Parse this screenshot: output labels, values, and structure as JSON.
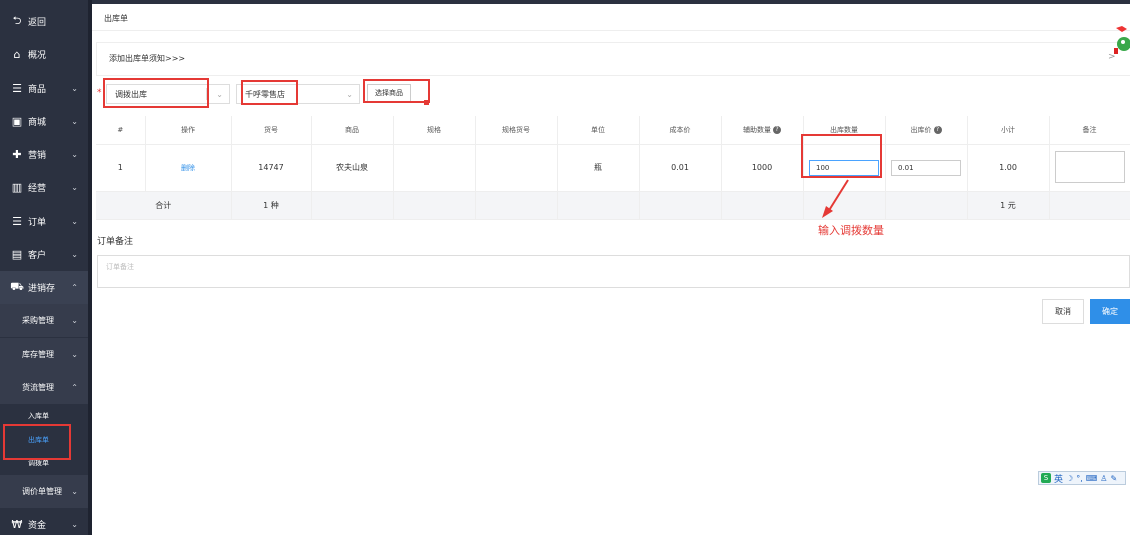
{
  "sidebar": {
    "items": [
      {
        "label": "返回",
        "icon": "back-arrow-icon",
        "glyph": "⮌"
      },
      {
        "label": "概况",
        "icon": "home-icon",
        "glyph": "⌂"
      },
      {
        "label": "商品",
        "icon": "list-icon",
        "glyph": "☰"
      },
      {
        "label": "商城",
        "icon": "shop-bag-icon",
        "glyph": "▣"
      },
      {
        "label": "营销",
        "icon": "gift-icon",
        "glyph": "✚"
      },
      {
        "label": "经营",
        "icon": "bar-chart-icon",
        "glyph": "▥"
      },
      {
        "label": "订单",
        "icon": "order-list-icon",
        "glyph": "☰"
      },
      {
        "label": "客户",
        "icon": "id-card-icon",
        "glyph": "▤"
      },
      {
        "label": "进销存",
        "icon": "truck-icon",
        "glyph": "⛟"
      }
    ],
    "sub_items": [
      {
        "label": "采购管理"
      },
      {
        "label": "库存管理"
      },
      {
        "label": "货流管理"
      }
    ],
    "leaf_items": [
      {
        "label": "入库单"
      },
      {
        "label": "出库单"
      },
      {
        "label": "调拨单"
      }
    ],
    "more_items": [
      {
        "label": "调价单管理"
      }
    ],
    "bottom_item": {
      "label": "资金",
      "icon": "currency-icon",
      "glyph": "₩"
    }
  },
  "panel": {
    "title": "出库单",
    "notice": "添加出库单须知>>>",
    "notice_arrow": ">"
  },
  "form": {
    "required_mark": "*",
    "type_select": "调拨出库",
    "store_select": "千呼零售店",
    "choose_button": "选择商品"
  },
  "table": {
    "headers": [
      "#",
      "操作",
      "货号",
      "商品",
      "规格",
      "规格货号",
      "单位",
      "成本价",
      "辅助数量",
      "出库数量",
      "出库价",
      "小计",
      "备注"
    ],
    "rows": [
      {
        "index": "1",
        "action": "删除",
        "sku": "14747",
        "name": "农夫山泉",
        "spec": "",
        "spec_sku": "",
        "unit": "瓶",
        "cost": "0.01",
        "aux_qty": "1000",
        "out_qty": "100",
        "out_price": "0.01",
        "subtotal": "1.00"
      }
    ],
    "total": {
      "label": "合计",
      "sku_count": "1 种",
      "subtotal": "1 元"
    }
  },
  "annotation": {
    "text": "输入调拨数量",
    "color": "#e53935"
  },
  "remark": {
    "label": "订单备注",
    "placeholder": "订单备注"
  },
  "actions": {
    "cancel": "取消",
    "confirm": "确定"
  },
  "ime": {
    "lang": "英",
    "icons": [
      "sogou-logo-icon",
      "moon-icon",
      "punctuation-icon",
      "keyboard-icon",
      "user-icon",
      "wrench-icon"
    ]
  },
  "colors": {
    "sidebar_bg": "#2b3140",
    "accent": "#2f8fe8",
    "highlight_red": "#e53935"
  }
}
